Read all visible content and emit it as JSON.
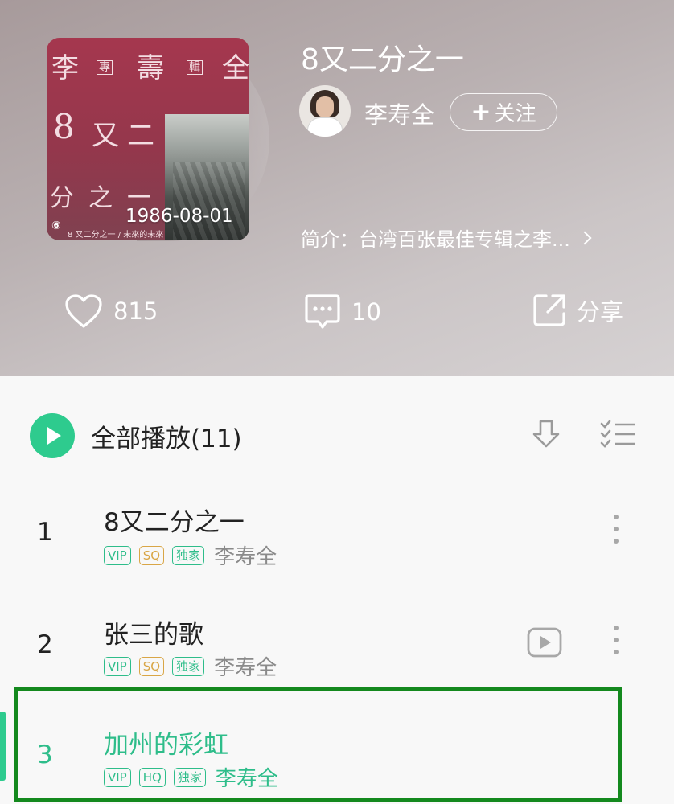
{
  "album": {
    "title": "8又二分之一",
    "release_date": "1986-08-01",
    "cover_text": {
      "li": "李",
      "zhuan": "專",
      "shou": "壽",
      "ji": "輯",
      "quan": "全",
      "eight": "8",
      "you": "又",
      "er": "二",
      "fen": "分",
      "zhi": "之",
      "yi": "一",
      "bottom": "8 又二分之一 / 未來的未來"
    },
    "artist": "李寿全",
    "follow_label": "关注",
    "intro": "简介：台湾百张最佳专辑之李..."
  },
  "actions": {
    "like_count": "815",
    "comment_count": "10",
    "share_label": "分享"
  },
  "list": {
    "play_all_label": "全部播放(11)",
    "songs": [
      {
        "num": "1",
        "title": "8又二分之一",
        "tags": [
          "VIP",
          "SQ",
          "独家"
        ],
        "artist": "李寿全"
      },
      {
        "num": "2",
        "title": "张三的歌",
        "tags": [
          "VIP",
          "SQ",
          "独家"
        ],
        "artist": "李寿全"
      },
      {
        "num": "3",
        "title": "加州的彩虹",
        "tags": [
          "VIP",
          "HQ",
          "独家"
        ],
        "artist": "李寿全"
      }
    ]
  },
  "colors": {
    "accent": "#2ecb8e",
    "sq": "#d9a646",
    "highlight_box": "#14891e"
  }
}
